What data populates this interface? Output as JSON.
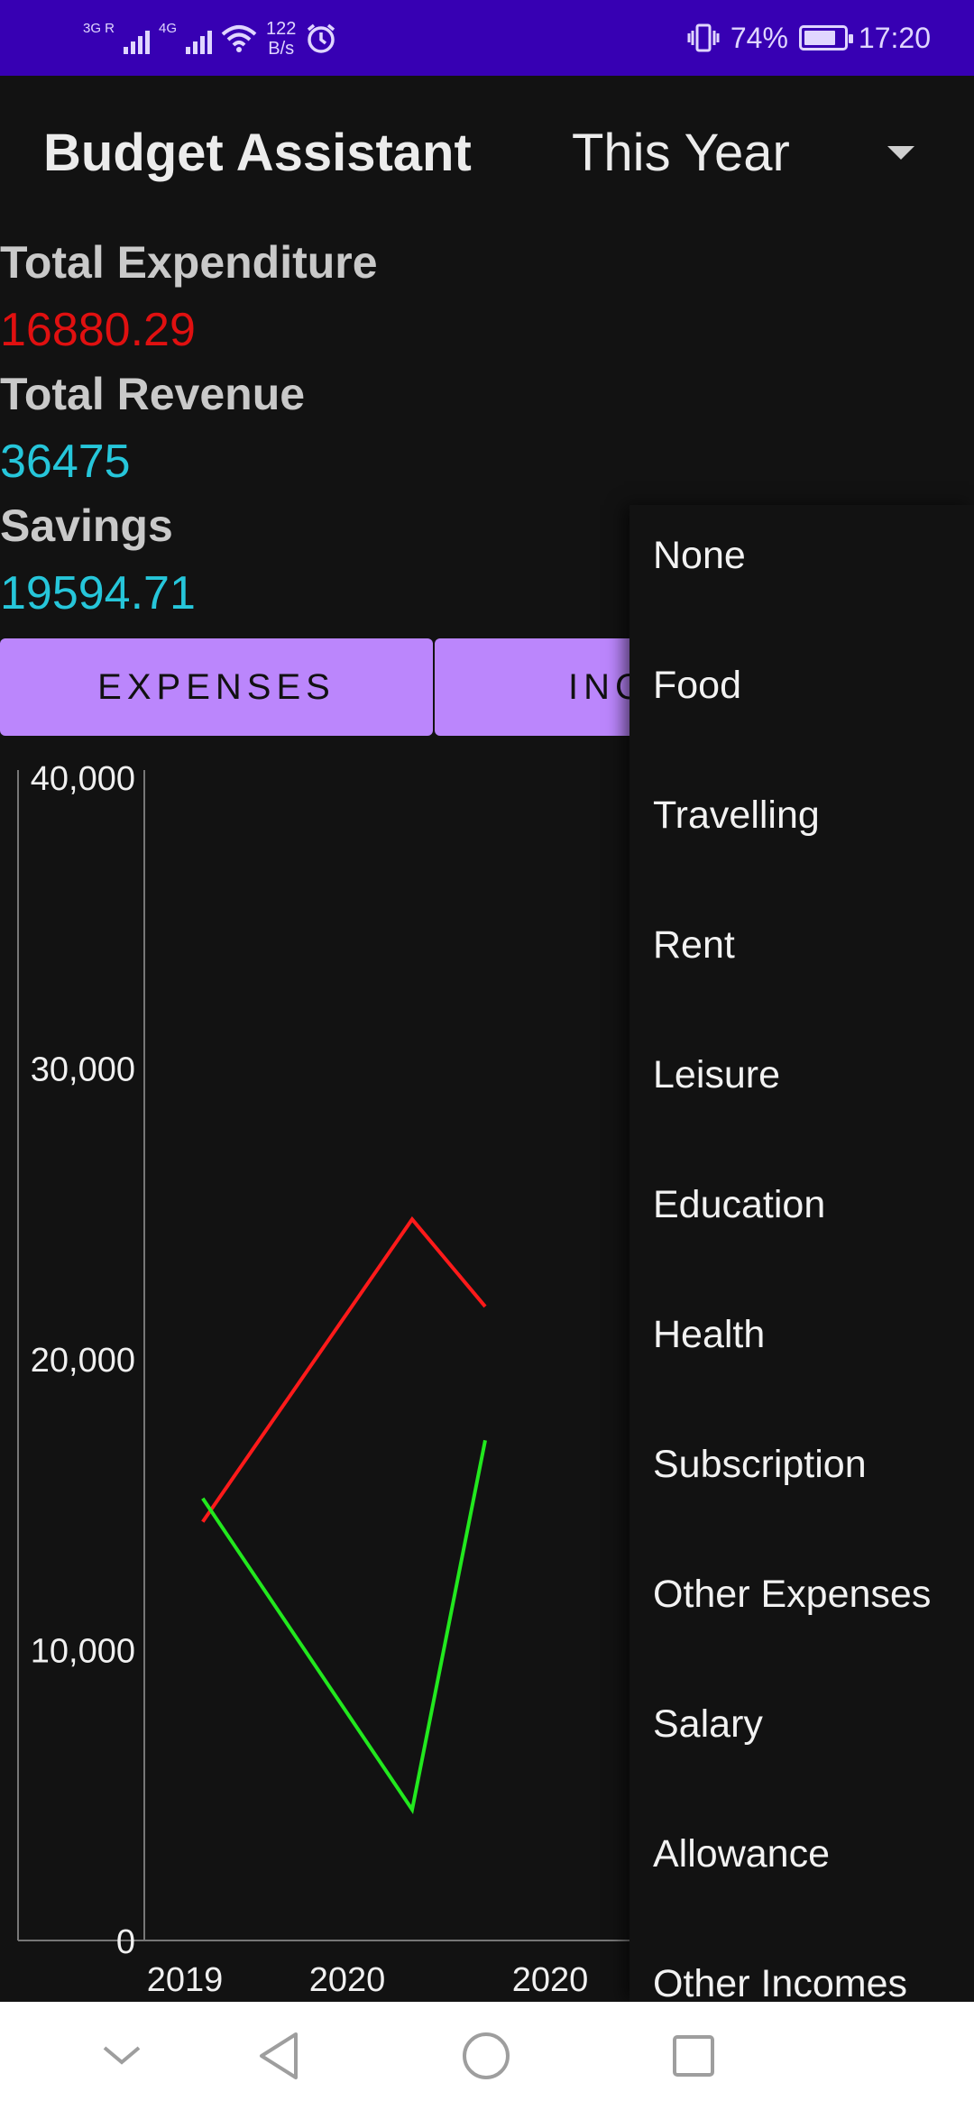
{
  "status_bar": {
    "network_1": "3G R",
    "network_2": "4G",
    "speed_value": "122",
    "speed_unit": "B/s",
    "battery": "74%",
    "time": "17:20"
  },
  "app": {
    "title": "Budget Assistant",
    "period": "This Year"
  },
  "summary": {
    "expenditure_label": "Total Expenditure",
    "expenditure_value": "16880.29",
    "revenue_label": "Total Revenue",
    "revenue_value": "36475",
    "savings_label": "Savings",
    "savings_value": "19594.71"
  },
  "tabs": {
    "expenses": "EXPENSES",
    "income_visible": "INC"
  },
  "menu": {
    "items": [
      "None",
      "Food",
      "Travelling",
      "Rent",
      "Leisure",
      "Education",
      "Health",
      "Subscription",
      "Other Expenses",
      "Salary",
      "Allowance",
      "Other Incomes"
    ]
  },
  "colors": {
    "status_bar": "#3700b3",
    "tab_bg": "#bb86fc",
    "expenditure": "#e01010",
    "revenue": "#26c6da",
    "series_red": "#ff1a1a",
    "series_green": "#22e81e"
  },
  "chart_data": {
    "type": "line",
    "y_ticks": [
      "40,000",
      "30,000",
      "20,000",
      "10,000",
      "0"
    ],
    "x_ticks": [
      "2019",
      "2020",
      "2020"
    ],
    "ylim": [
      0,
      40000
    ],
    "series": [
      {
        "color": "#ff1a1a",
        "points": [
          [
            0.12,
            14400
          ],
          [
            0.55,
            24800
          ],
          [
            0.7,
            21800
          ]
        ]
      },
      {
        "color": "#22e81e",
        "points": [
          [
            0.12,
            15200
          ],
          [
            0.55,
            4500
          ],
          [
            0.7,
            17200
          ]
        ]
      }
    ]
  },
  "nav": {
    "icons": [
      "chevron-down-icon",
      "back-icon",
      "home-icon",
      "recents-icon"
    ]
  }
}
